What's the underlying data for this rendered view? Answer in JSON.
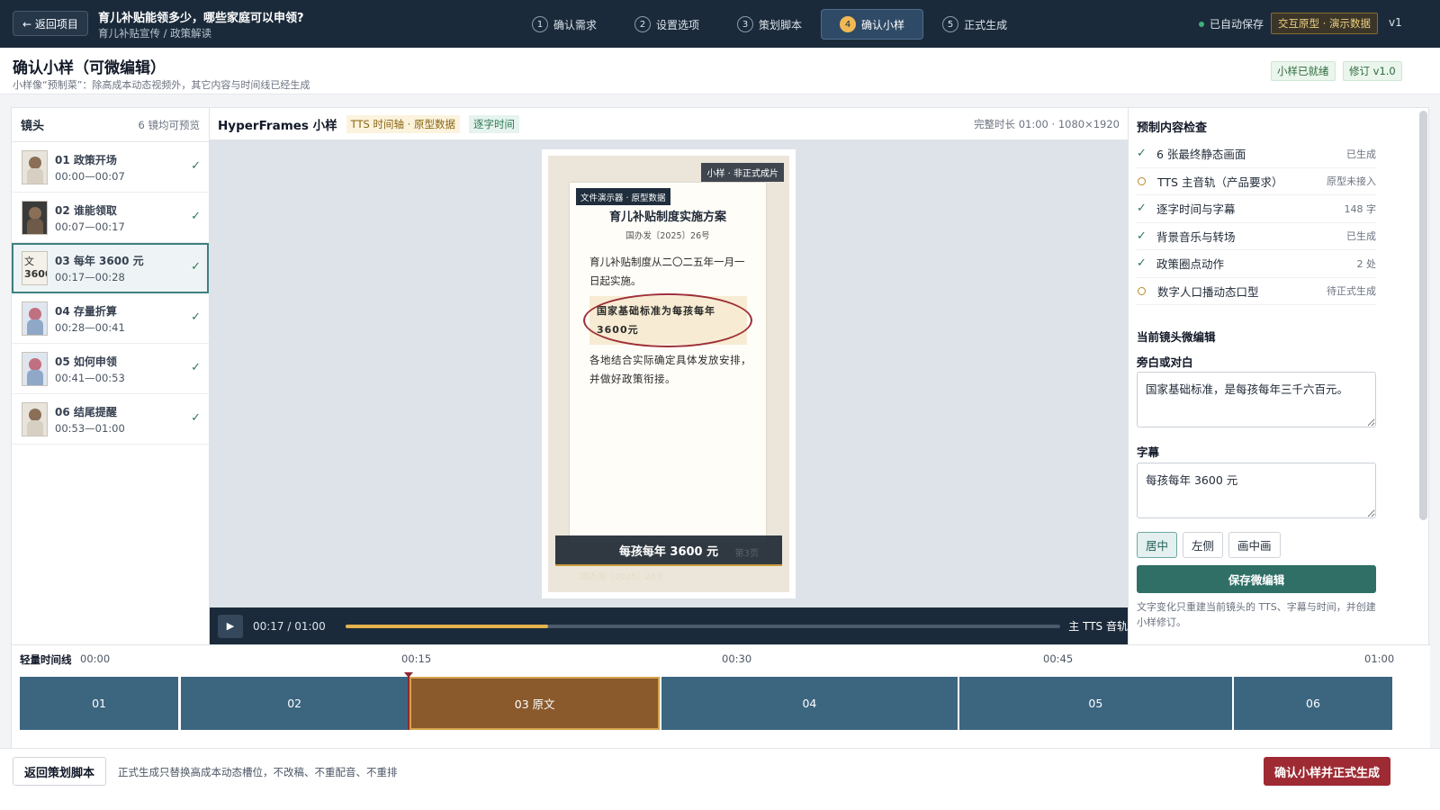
{
  "topbar": {
    "back_label": "← 返回项目",
    "title": "育儿补贴能领多少，哪些家庭可以申领?",
    "subtitle": "育儿补贴宣传 / 政策解读",
    "steps": [
      {
        "num": "1",
        "label": "确认需求"
      },
      {
        "num": "2",
        "label": "设置选项"
      },
      {
        "num": "3",
        "label": "策划脚本"
      },
      {
        "num": "4",
        "label": "确认小样"
      },
      {
        "num": "5",
        "label": "正式生成"
      }
    ],
    "active_step": 4,
    "autosave": "已自动保存",
    "prototype_badge": "交互原型 · 演示数据",
    "version": "v1"
  },
  "page": {
    "title": "确认小样（可微编辑）",
    "subtitle": "小样像“预制菜”：除高成本动态视频外，其它内容与时间线已经生成",
    "tag_ready": "小样已就绪",
    "tag_revision": "修订 v1.0"
  },
  "shots": {
    "title": "镜头",
    "count_note": "6 镜均可预览",
    "items": [
      {
        "name": "01 政策开场",
        "time": "00:00—00:07",
        "thumb": "person",
        "done": "✓"
      },
      {
        "name": "02 谁能领取",
        "time": "00:07—00:17",
        "thumb": "dark",
        "done": "✓"
      },
      {
        "name": "03 每年 3600 元",
        "time": "00:17—00:28",
        "thumb": "text",
        "thumb_text_1": "文",
        "thumb_text_2": "3600",
        "done": "✓"
      },
      {
        "name": "04 存量折算",
        "time": "00:28—00:41",
        "thumb": "blue",
        "done": "✓"
      },
      {
        "name": "05 如何申领",
        "time": "00:41—00:53",
        "thumb": "blue",
        "done": "✓"
      },
      {
        "name": "06 结尾提醒",
        "time": "00:53—01:00",
        "thumb": "person",
        "done": "✓"
      }
    ],
    "active_index": 2
  },
  "preview": {
    "title": "HyperFrames 小样",
    "chip_tts": "TTS 时间轴 · 原型数据",
    "chip_word": "逐字时间",
    "meta": "完整时长 01:00 · 1080×1920",
    "sample_tag": "小样 · 非正式成片",
    "doc_tag": "文件演示器 · 原型数据",
    "doc_title": "育儿补贴制度实施方案",
    "doc_no": "国办发〔2025〕26号",
    "doc_p1": "育儿补贴制度从二〇二五年一月一日起实施。",
    "doc_highlight": "国家基础标准为每孩每年3600元",
    "doc_p2": "各地结合实际确定具体发放安排，并做好政策衔接。",
    "subtitle": "每孩每年 3600 元",
    "page_mark": "第3页",
    "ghost_text": "国办发〔2025〕26号",
    "player": {
      "play_icon": "play-icon",
      "time": "00:17 / 01:00",
      "progress": 0.2833,
      "track_label": "主 TTS 音轨"
    }
  },
  "checks": {
    "title": "预制内容检查",
    "items": [
      {
        "label": "6 张最终静态画面",
        "status": "已生成",
        "ok": true
      },
      {
        "label": "TTS 主音轨（产品要求）",
        "status": "原型未接入",
        "ok": false
      },
      {
        "label": "逐字时间与字幕",
        "status": "148 字",
        "ok": true
      },
      {
        "label": "背景音乐与转场",
        "status": "已生成",
        "ok": true
      },
      {
        "label": "政策圈点动作",
        "status": "2 处",
        "ok": true
      },
      {
        "label": "数字人口播动态口型",
        "status": "待正式生成",
        "ok": false
      }
    ],
    "check_glyph": "✓"
  },
  "editor": {
    "title": "当前镜头微编辑",
    "narration_label": "旁白或对白",
    "narration_value": "国家基础标准，是每孩每年三千六百元。",
    "subtitle_label": "字幕",
    "subtitle_value": "每孩每年 3600 元",
    "positions": [
      "居中",
      "左侧",
      "画中画"
    ],
    "position_selected": "居中",
    "save_label": "保存微编辑",
    "hint": "文字变化只重建当前镜头的 TTS、字幕与时间，并创建小样修订。"
  },
  "timeline": {
    "label": "轻量时间线",
    "ticks": [
      "00:00",
      "00:15",
      "00:30",
      "00:45",
      "01:00"
    ],
    "duration_s": 60,
    "playhead_s": 17,
    "clips": [
      {
        "label": "01",
        "start": 0,
        "end": 7
      },
      {
        "label": "02",
        "start": 7,
        "end": 17
      },
      {
        "label": "03 原文",
        "start": 17,
        "end": 28,
        "active": true
      },
      {
        "label": "04",
        "start": 28,
        "end": 41
      },
      {
        "label": "05",
        "start": 41,
        "end": 53
      },
      {
        "label": "06",
        "start": 53,
        "end": 60
      }
    ]
  },
  "footer": {
    "back_label": "返回策划脚本",
    "note": "正式生成只替换高成本动态槽位，不改稿、不重配音、不重排",
    "confirm_label": "确认小样并正式生成"
  },
  "colors": {
    "topbar": "#1b2a3a",
    "accent_gold": "#f0b955",
    "primary_teal": "#2f6f66",
    "danger": "#9e2a33",
    "clip": "#3c6680",
    "clip_active": "#8a5a2c"
  }
}
